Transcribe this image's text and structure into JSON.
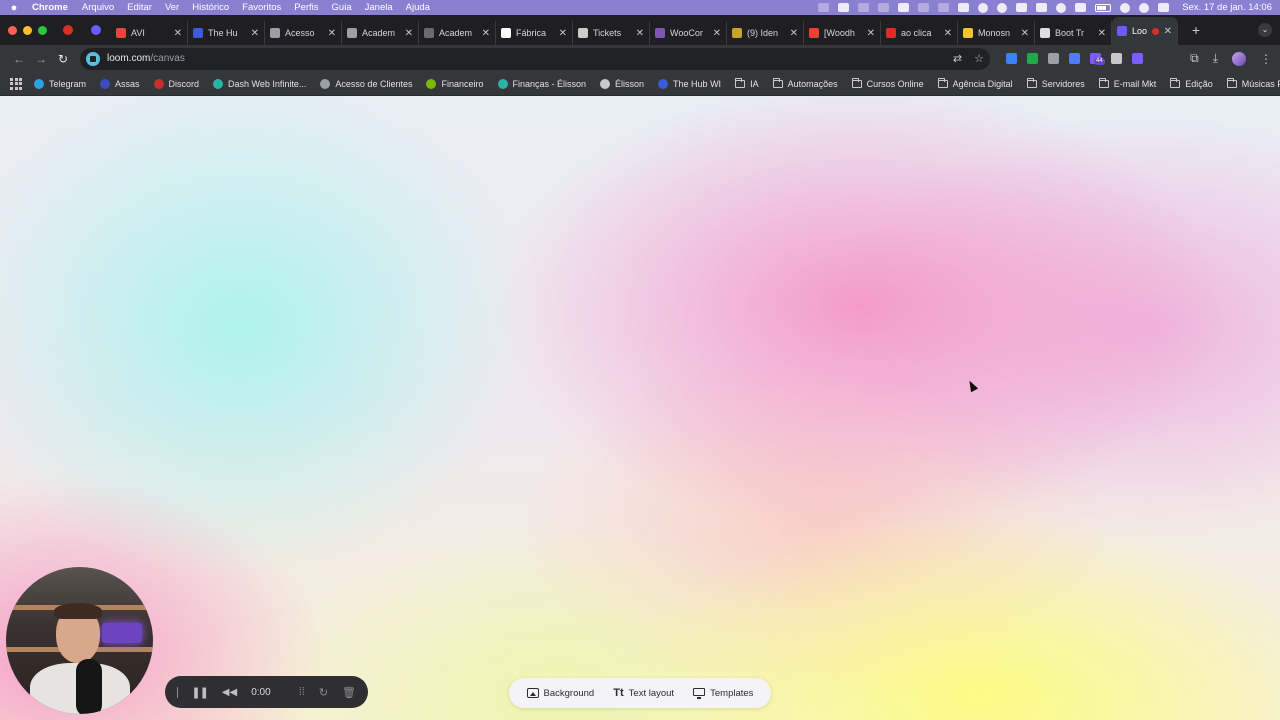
{
  "menubar": {
    "app_name": "Chrome",
    "items": [
      "Arquivo",
      "Editar",
      "Ver",
      "Histórico",
      "Favoritos",
      "Perfis",
      "Guia",
      "Janela",
      "Ajuda"
    ],
    "clock": "Sex. 17 de jan.  14:06"
  },
  "tabs": [
    {
      "label": "AVI",
      "color": "#e8453c"
    },
    {
      "label": "The Hu",
      "color": "#3b5bdb"
    },
    {
      "label": "Acesso",
      "color": "#9aa0a6"
    },
    {
      "label": "Academ",
      "color": "#9aa0a6"
    },
    {
      "label": "Academ",
      "color": "#6b6b6b"
    },
    {
      "label": "Fábrica",
      "color": "#ffffff"
    },
    {
      "label": "Tickets",
      "color": "#cccccc"
    },
    {
      "label": "WooCor",
      "color": "#7f54b3"
    },
    {
      "label": "(9) Iden",
      "color": "#c9a227"
    },
    {
      "label": "[Woodh",
      "color": "#ea4335"
    },
    {
      "label": "ao clica",
      "color": "#d93025"
    },
    {
      "label": "Monosn",
      "color": "#f4c430"
    },
    {
      "label": "Boot Tr",
      "color": "#dddddd"
    }
  ],
  "active_tab": {
    "label": "Loom",
    "color": "#6a5cff"
  },
  "omnibox": {
    "host": "loom.com",
    "path": "/canvas"
  },
  "bookmarks": [
    {
      "label": "Telegram",
      "kind": "site",
      "color": "#2aa3e0"
    },
    {
      "label": "Assas",
      "kind": "site",
      "color": "#3b4cc0"
    },
    {
      "label": "Discord",
      "kind": "site",
      "color": "#c9302c"
    },
    {
      "label": "Dash Web Infinite...",
      "kind": "site",
      "color": "#2bb3a3"
    },
    {
      "label": "Acesso de Clientes",
      "kind": "site",
      "color": "#9aa0a6"
    },
    {
      "label": "Financeiro",
      "kind": "site",
      "color": "#7ab800"
    },
    {
      "label": "Finanças - Élisson",
      "kind": "site",
      "color": "#2bb3a3"
    },
    {
      "label": "Élisson",
      "kind": "site",
      "color": "#c8c8cc"
    },
    {
      "label": "The Hub WI",
      "kind": "site",
      "color": "#3b5bdb"
    },
    {
      "label": "IA",
      "kind": "folder"
    },
    {
      "label": "Automações",
      "kind": "folder"
    },
    {
      "label": "Cursos Online",
      "kind": "folder"
    },
    {
      "label": "Agência Digital",
      "kind": "folder"
    },
    {
      "label": "Servidores",
      "kind": "folder"
    },
    {
      "label": "E-mail Mkt",
      "kind": "folder"
    },
    {
      "label": "Edição",
      "kind": "folder"
    },
    {
      "label": "Músicas Foco",
      "kind": "folder"
    }
  ],
  "extensions": [
    {
      "color": "#3b82f6"
    },
    {
      "color": "#22a94f"
    },
    {
      "color": "#9aa0a6"
    },
    {
      "color": "#4f7cff"
    },
    {
      "color": "#7c5cff",
      "badge": "44"
    },
    {
      "color": "#c8c8cc"
    },
    {
      "color": "#7a5cff"
    }
  ],
  "recorder": {
    "time": "0:00"
  },
  "canvas_menu": {
    "background": "Background",
    "text_layout": "Text layout",
    "templates": "Templates"
  }
}
